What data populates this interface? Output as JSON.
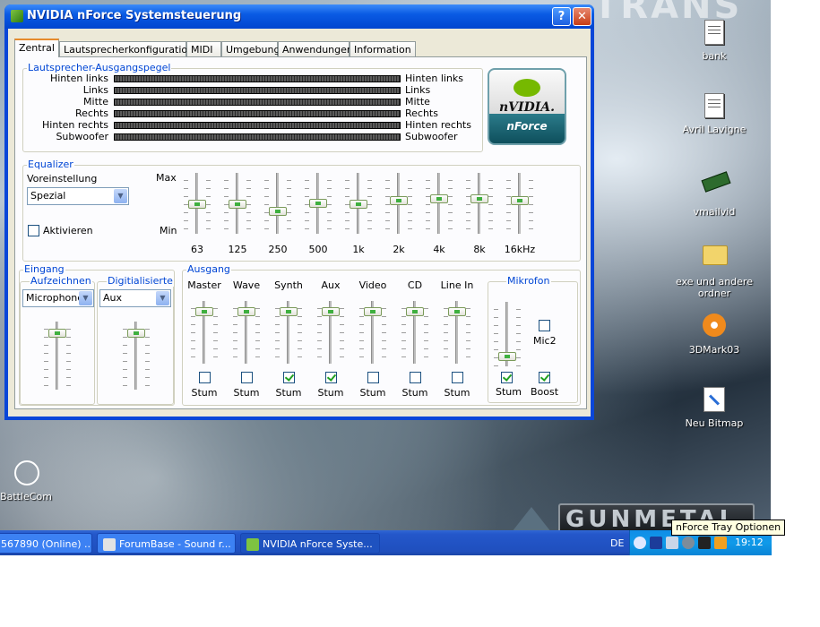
{
  "window": {
    "title": "NVIDIA nForce Systemsteuerung",
    "help": "?",
    "close": "✕"
  },
  "tabs": [
    "Zentral",
    "Lautsprecherkonfiguration",
    "MIDI",
    "Umgebung",
    "Anwendungen",
    "Information"
  ],
  "levels": {
    "title": "Lautsprecher-Ausgangspegel",
    "channels": [
      "Hinten links",
      "Links",
      "Mitte",
      "Rechts",
      "Hinten rechts",
      "Subwoofer"
    ]
  },
  "brand": {
    "name": "nVIDIA.",
    "product": "nForce"
  },
  "equalizer": {
    "title": "Equalizer",
    "preset_label": "Voreinstellung",
    "preset": "Spezial",
    "activate": "Aktivieren",
    "activate_checked": false,
    "max": "Max",
    "min": "Min",
    "bands": [
      {
        "label": "63",
        "level": 0.48
      },
      {
        "label": "125",
        "level": 0.48
      },
      {
        "label": "250",
        "level": 0.35
      },
      {
        "label": "500",
        "level": 0.5
      },
      {
        "label": "1k",
        "level": 0.48
      },
      {
        "label": "2k",
        "level": 0.55
      },
      {
        "label": "4k",
        "level": 0.58
      },
      {
        "label": "8k",
        "level": 0.58
      },
      {
        "label": "16kHz",
        "level": 0.56
      }
    ]
  },
  "input": {
    "title": "Eingang",
    "record_label": "Aufzeichnen",
    "record_value": "Microphone",
    "digital_label": "Digitialisierte",
    "digital_value": "Aux",
    "record_level": 0.88,
    "digital_level": 0.88
  },
  "output": {
    "title": "Ausgang",
    "mute_label": "Stum",
    "channels": [
      {
        "name": "Master",
        "level": 0.88,
        "mute": false
      },
      {
        "name": "Wave",
        "level": 0.88,
        "mute": false
      },
      {
        "name": "Synth",
        "level": 0.88,
        "mute": true
      },
      {
        "name": "Aux",
        "level": 0.88,
        "mute": true
      },
      {
        "name": "Video",
        "level": 0.88,
        "mute": false
      },
      {
        "name": "CD",
        "level": 0.88,
        "mute": false
      },
      {
        "name": "Line In",
        "level": 0.88,
        "mute": false
      }
    ]
  },
  "mic": {
    "title": "Mikrofon",
    "level": 0.1,
    "mute_label": "Stum",
    "mute": true,
    "mic2": "Mic2",
    "mic2_checked": false,
    "boost": "Boost",
    "boost_checked": true
  },
  "desktop_icons": [
    "bank",
    "Avril Lavigne",
    "vmailvid",
    "exe und andere ordner",
    "3DMark03",
    "Neu Bitmap",
    "BattleCom"
  ],
  "taskbar": {
    "items": [
      "567890 (Online) ...",
      "ForumBase - Sound r...",
      "NVIDIA nForce Syste..."
    ],
    "lang": "DE",
    "clock": "19:12",
    "tooltip": "nForce Tray Optionen"
  },
  "wallpaper": {
    "top_text": "TRANS",
    "logo": "GUNMETAL"
  }
}
